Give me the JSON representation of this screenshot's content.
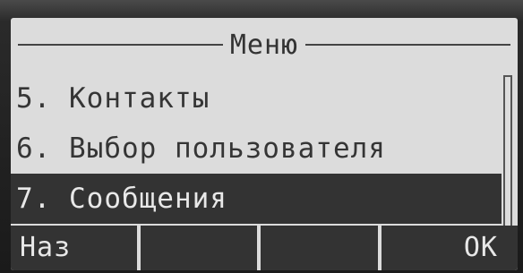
{
  "screen": {
    "title": "Меню"
  },
  "menu": {
    "items": [
      {
        "label": "5. Контакты"
      },
      {
        "label": "6. Выбор пользователя"
      },
      {
        "label": "7. Сообщения",
        "selected": true
      }
    ]
  },
  "softkeys": [
    {
      "label": "Наз"
    },
    {
      "label": ""
    },
    {
      "label": ""
    },
    {
      "label": "OK"
    }
  ],
  "colors": {
    "screen_bg": "#dcdcdc",
    "highlight_bg": "#333333",
    "highlight_text": "#e8e8e8"
  }
}
